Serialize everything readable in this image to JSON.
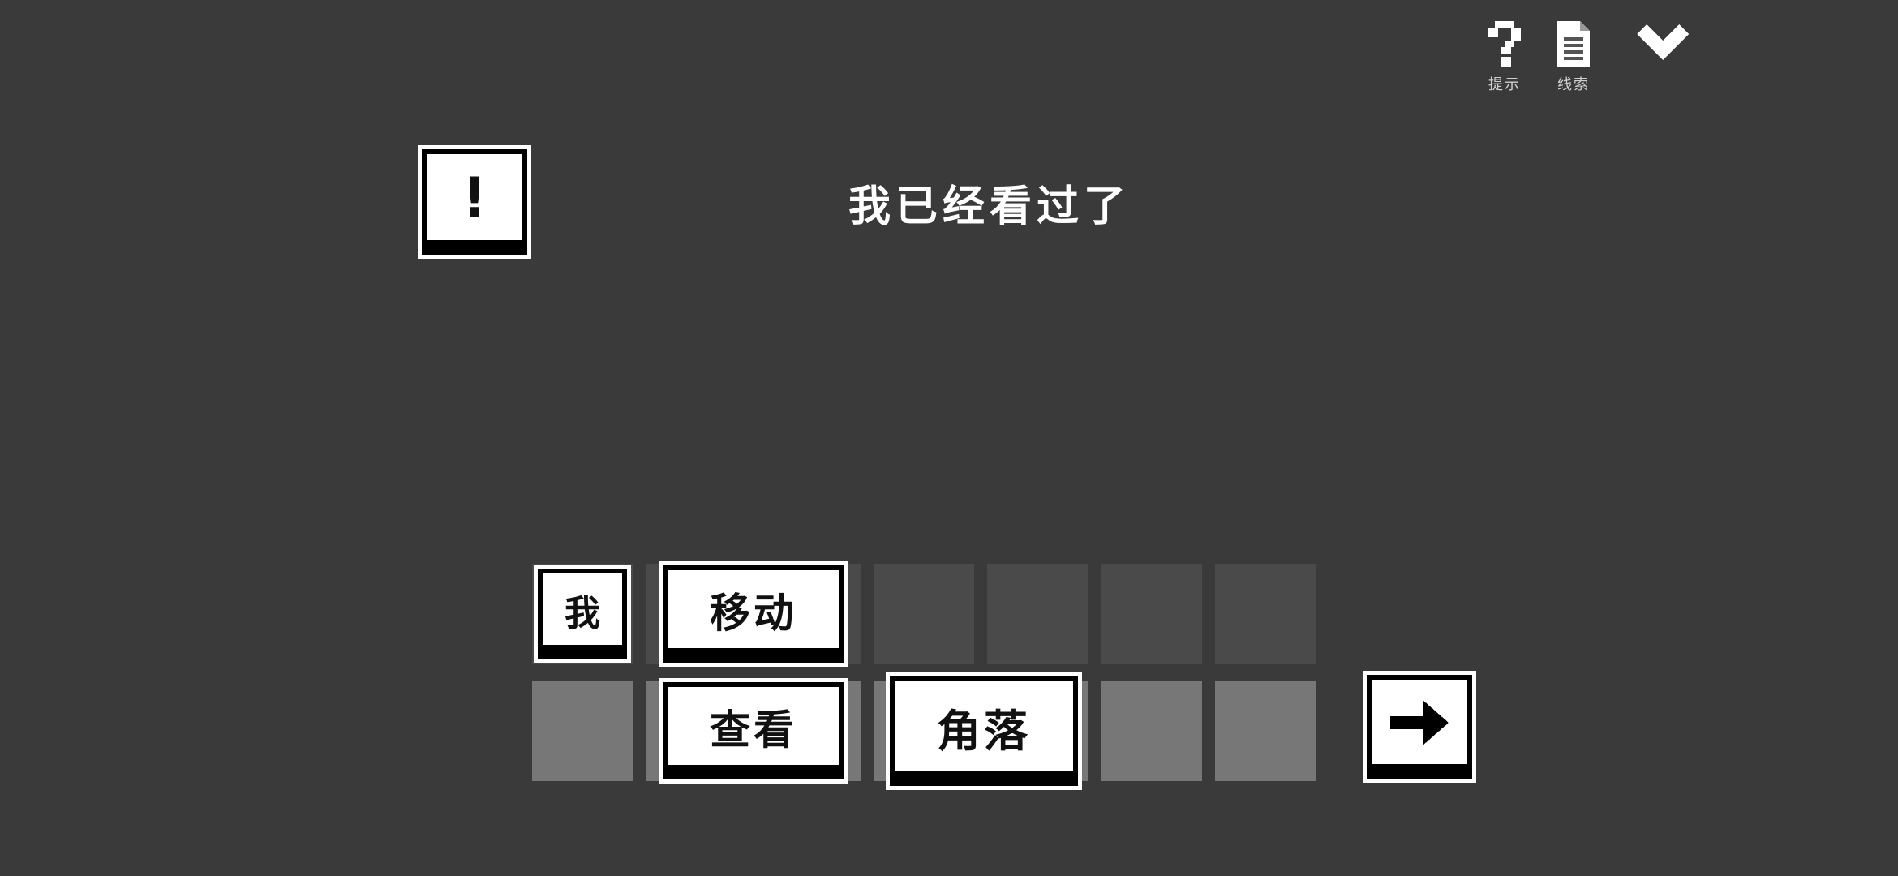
{
  "toolbar": {
    "hint_label": "提示",
    "clues_label": "线索"
  },
  "dialog": {
    "alert_symbol": "!",
    "message": "我已经看过了"
  },
  "word_rows": {
    "row1": {
      "subject": "我",
      "verb": "移动"
    },
    "row2": {
      "verb": "查看",
      "object": "角落"
    }
  },
  "icons": {
    "hint": "question-mark-icon",
    "clues": "document-icon",
    "collapse": "chevron-down-icon",
    "submit": "arrow-right-icon"
  }
}
